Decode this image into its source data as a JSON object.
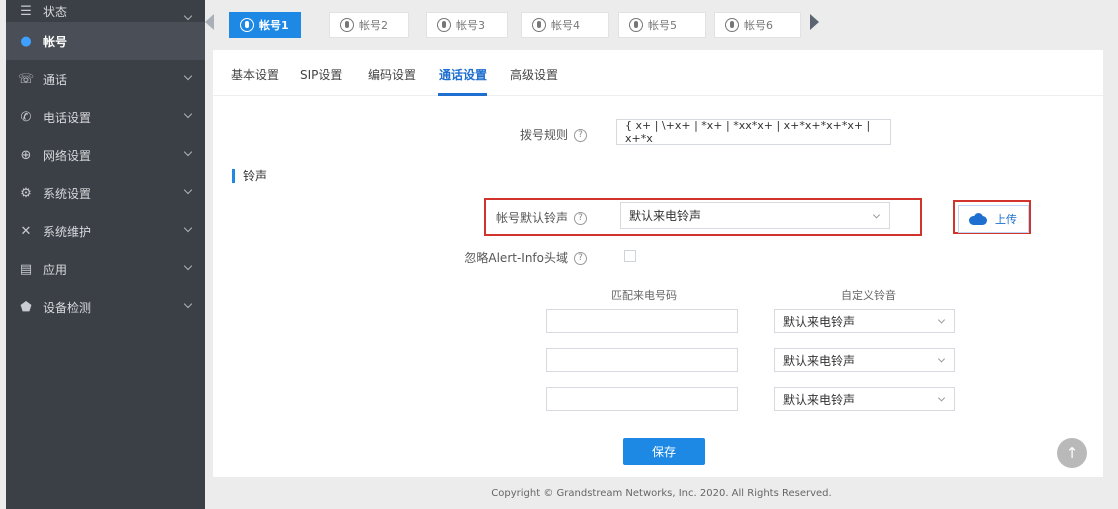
{
  "sidebar": {
    "items": [
      {
        "label": "状态",
        "icon": "list-icon"
      },
      {
        "label": "帐号",
        "icon": "user-icon"
      },
      {
        "label": "通话",
        "icon": "call-icon"
      },
      {
        "label": "电话设置",
        "icon": "phone-icon"
      },
      {
        "label": "网络设置",
        "icon": "network-icon"
      },
      {
        "label": "系统设置",
        "icon": "settings-icon"
      },
      {
        "label": "系统维护",
        "icon": "tools-icon"
      },
      {
        "label": "应用",
        "icon": "app-icon"
      },
      {
        "label": "设备检测",
        "icon": "shield-icon"
      }
    ]
  },
  "account_tabs": [
    "帐号1",
    "帐号2",
    "帐号3",
    "帐号4",
    "帐号5",
    "帐号6"
  ],
  "sub_tabs": [
    "基本设置",
    "SIP设置",
    "编码设置",
    "通话设置",
    "高级设置"
  ],
  "form": {
    "dial_plan_label": "拨号规则",
    "dial_plan_value": "{ x+ | \\+x+ | *x+ | *xx*x+ | x+*x+*x+*x+ | x+*x",
    "section_title": "铃声",
    "default_ringtone_label": "帐号默认铃声",
    "default_ringtone_value": "默认来电铃声",
    "upload_label": "上传",
    "ignore_alert_label": "忽略Alert-Info头域",
    "col_match_label": "匹配来电号码",
    "col_ring_label": "自定义铃音",
    "rows": [
      {
        "match": "",
        "ring": "默认来电铃声"
      },
      {
        "match": "",
        "ring": "默认来电铃声"
      },
      {
        "match": "",
        "ring": "默认来电铃声"
      }
    ],
    "save_label": "保存"
  },
  "footer": "Copyright © Grandstream Networks, Inc. 2020. All Rights Reserved.",
  "help_glyph": "?",
  "colors": {
    "accent": "#1e88e5",
    "sidebar": "#3b3f46",
    "highlight_box": "#d0342c"
  }
}
